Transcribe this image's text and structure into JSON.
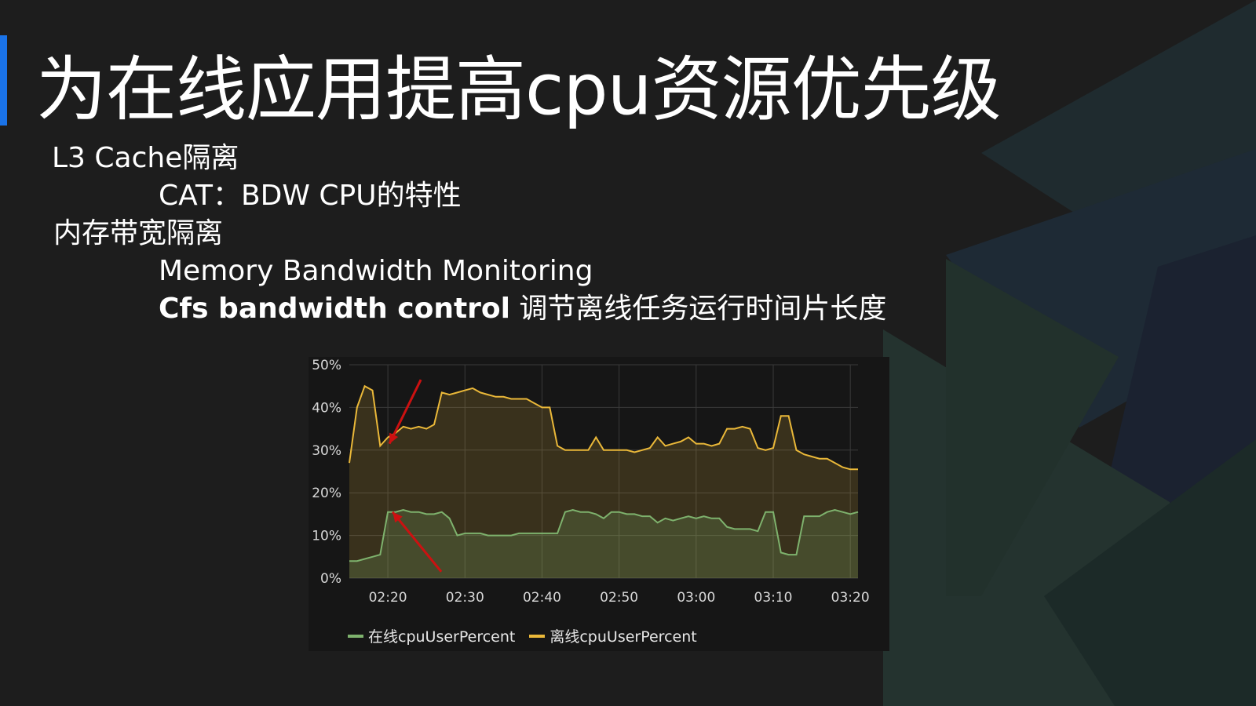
{
  "slide": {
    "title": "为在线应用提高cpu资源优先级",
    "accent_color": "#1a73e8",
    "background_color": "#1d1d1d"
  },
  "bullets": {
    "item1": "L3 Cache隔离",
    "item2": "CAT：BDW CPU的特性",
    "item3": "内存带宽隔离",
    "item4": "Memory Bandwidth Monitoring",
    "item5_bold": "Cfs bandwidth control",
    "item5_rest": " 调节离线任务运行时间片长度"
  },
  "chart_data": {
    "type": "area",
    "x": [
      "02:15",
      "02:16",
      "02:17",
      "02:18",
      "02:19",
      "02:20",
      "02:21",
      "02:22",
      "02:23",
      "02:24",
      "02:25",
      "02:26",
      "02:27",
      "02:28",
      "02:29",
      "02:30",
      "02:31",
      "02:32",
      "02:33",
      "02:34",
      "02:35",
      "02:36",
      "02:37",
      "02:38",
      "02:39",
      "02:40",
      "02:41",
      "02:42",
      "02:43",
      "02:44",
      "02:45",
      "02:46",
      "02:47",
      "02:48",
      "02:49",
      "02:50",
      "02:51",
      "02:52",
      "02:53",
      "02:54",
      "02:55",
      "02:56",
      "02:57",
      "02:58",
      "02:59",
      "03:00",
      "03:01",
      "03:02",
      "03:03",
      "03:04",
      "03:05",
      "03:06",
      "03:07",
      "03:08",
      "03:09",
      "03:10",
      "03:11",
      "03:12",
      "03:13",
      "03:14",
      "03:15",
      "03:16",
      "03:17",
      "03:18",
      "03:19",
      "03:20",
      "03:21"
    ],
    "x_ticks": [
      "02:20",
      "02:30",
      "02:40",
      "02:50",
      "03:00",
      "03:10",
      "03:20"
    ],
    "y_ticks": [
      "0%",
      "10%",
      "20%",
      "30%",
      "40%",
      "50%"
    ],
    "ylim": [
      0,
      50
    ],
    "grid": true,
    "legend_position": "bottom",
    "series": [
      {
        "name": "在线cpuUserPercent",
        "color": "#7eb26d",
        "values": [
          4,
          4,
          4.5,
          5,
          5.5,
          15.5,
          15.5,
          16,
          15.5,
          15.5,
          15,
          15,
          15.5,
          14,
          10,
          10.5,
          10.5,
          10.5,
          10,
          10,
          10,
          10,
          10.5,
          10.5,
          10.5,
          10.5,
          10.5,
          10.5,
          15.5,
          16,
          15.5,
          15.5,
          15,
          14,
          15.5,
          15.5,
          15,
          15,
          14.5,
          14.5,
          13,
          14,
          13.5,
          14,
          14.5,
          14,
          14.5,
          14,
          14,
          12,
          11.5,
          11.5,
          11.5,
          11,
          15.5,
          15.5,
          6,
          5.5,
          5.5,
          14.5,
          14.5,
          14.5,
          15.5,
          16,
          15.5,
          15,
          15.5
        ]
      },
      {
        "name": "离线cpuUserPercent",
        "color": "#eab839",
        "values": [
          27,
          40,
          45,
          44,
          31,
          33,
          34,
          35.5,
          35,
          35.5,
          35,
          36,
          43.5,
          43,
          43.5,
          44,
          44.5,
          43.5,
          43,
          42.5,
          42.5,
          42,
          42,
          42,
          41,
          40,
          40,
          31,
          30,
          30,
          30,
          30,
          33,
          30,
          30,
          30,
          30,
          29.5,
          30,
          30.5,
          33,
          31,
          31.5,
          32,
          33,
          31.5,
          31.5,
          31,
          31.5,
          35,
          35,
          35.5,
          35,
          30.5,
          30,
          30.5,
          38,
          38,
          30,
          29,
          28.5,
          28,
          28,
          27,
          26,
          25.5,
          25.5
        ]
      }
    ]
  },
  "annotations": {
    "arrow_color": "#cc1111"
  },
  "grid_color": "#3a3a3a",
  "axis_text_color": "#d8d8d8"
}
